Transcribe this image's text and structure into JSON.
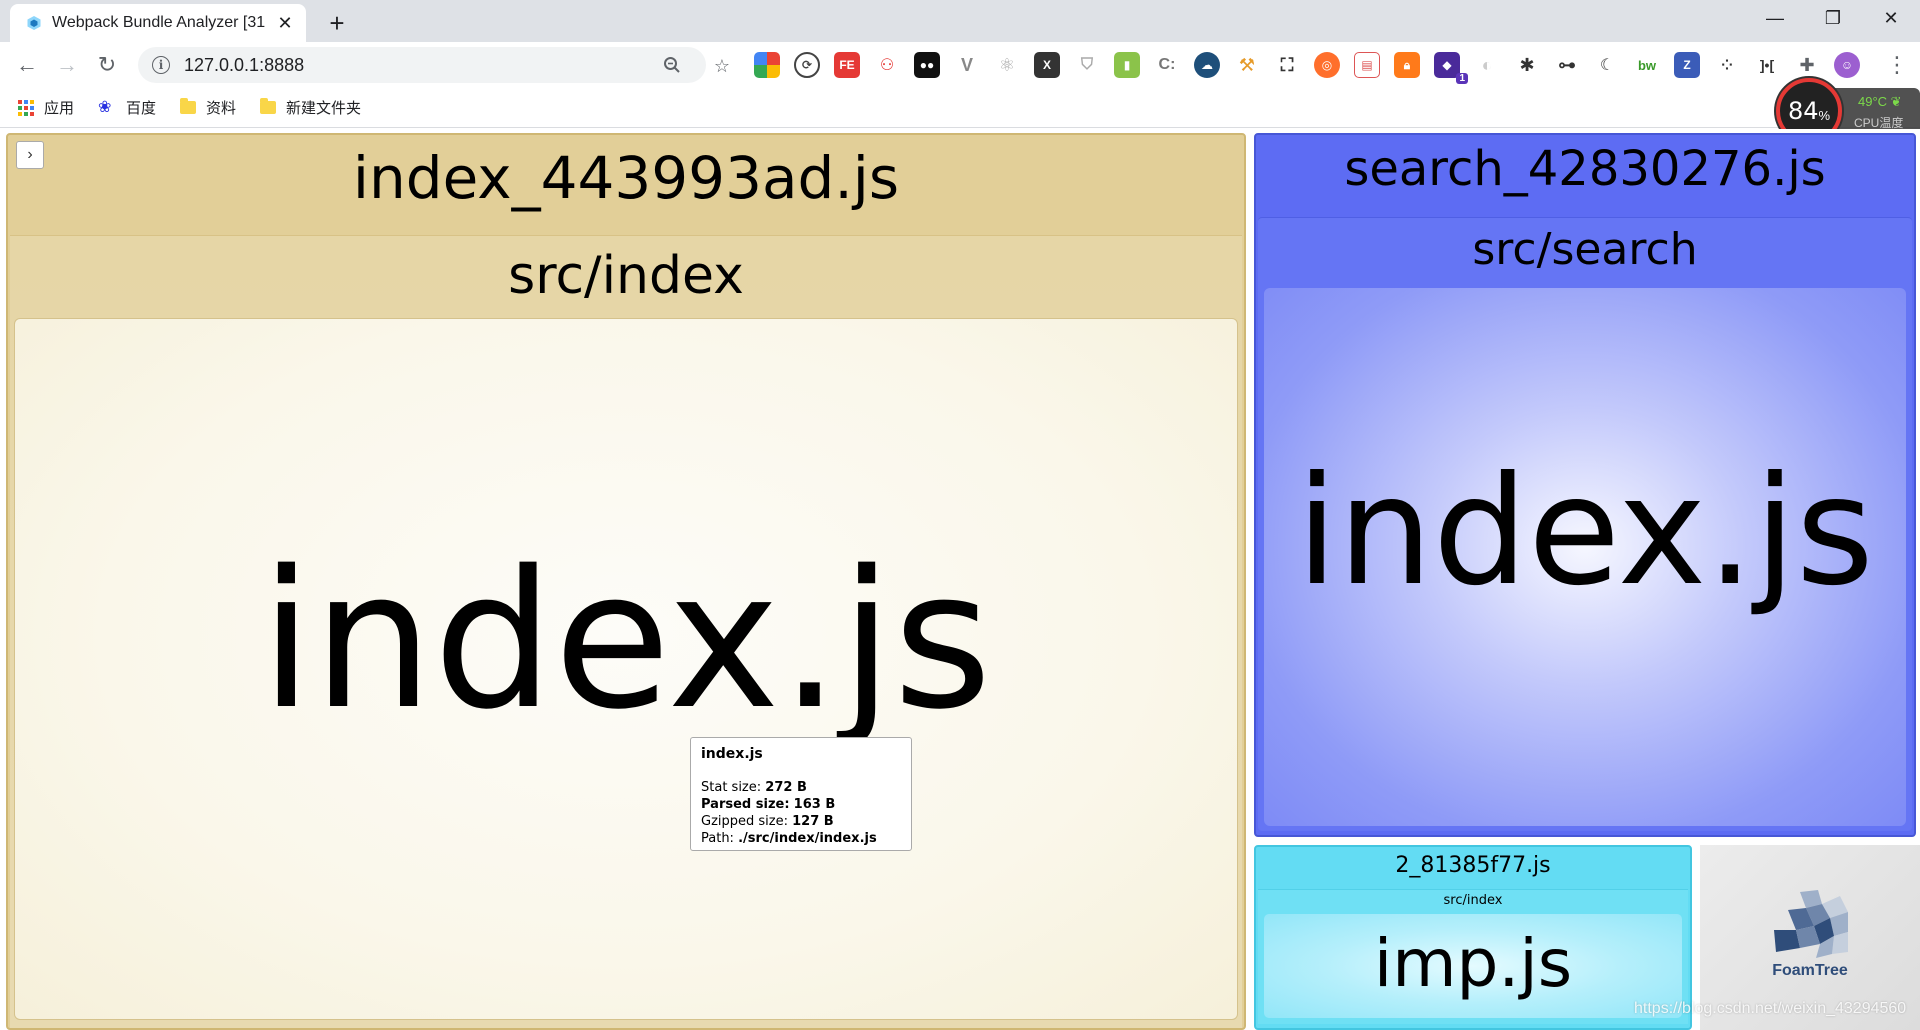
{
  "browser": {
    "tab_title": "Webpack Bundle Analyzer [31",
    "url": "127.0.0.1:8888",
    "bookmarks": [
      {
        "label": "应用",
        "icon": "apps-grid-icon"
      },
      {
        "label": "百度",
        "icon": "baidu-paw-icon"
      },
      {
        "label": "资料",
        "icon": "folder-icon"
      },
      {
        "label": "新建文件夹",
        "icon": "folder-icon"
      }
    ],
    "extension_badge": "1"
  },
  "cpu_widget": {
    "usage": "84",
    "unit": "%",
    "temperature": "49°C",
    "label": "CPU温度"
  },
  "treemap": {
    "index_bundle": {
      "title": "index_443993ad.js",
      "group": "src/index",
      "file": "index.js",
      "color": "#e0cc96"
    },
    "search_bundle": {
      "title": "search_42830276.js",
      "group": "src/search",
      "file": "index.js",
      "color": "#5b6bf2"
    },
    "chunk_bundle": {
      "title": "2_81385f77.js",
      "group": "src/index",
      "file": "imp.js",
      "color": "#5fdcf2"
    },
    "logo_text": "FoamTree"
  },
  "tooltip": {
    "title": "index.js",
    "stat_label": "Stat size:",
    "stat_value": "272 B",
    "parsed_label": "Parsed size:",
    "parsed_value": "163 B",
    "gzip_label": "Gzipped size:",
    "gzip_value": "127 B",
    "path_label": "Path:",
    "path_value": "./src/index/index.js"
  },
  "watermark": "https://blog.csdn.net/weixin_43294560"
}
